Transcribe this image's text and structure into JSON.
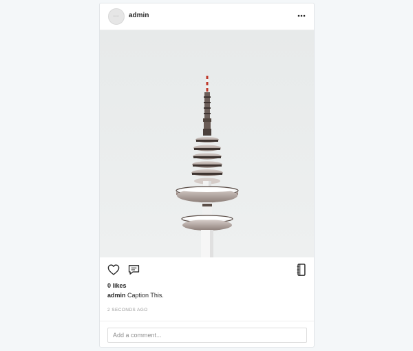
{
  "post": {
    "username": "admin",
    "avatar_icon": "avatar-placeholder-icon",
    "more_icon": "more-options-icon",
    "image_subject": "tower-image",
    "actions": {
      "like_icon": "heart-icon",
      "comment_icon": "comment-icon",
      "bookmark_icon": "bookmark-icon"
    },
    "likes_text": "0 likes",
    "caption": {
      "user": "admin",
      "text": "Caption This."
    },
    "timestamp": "2 seconds ago",
    "comment_placeholder": "Add a comment..."
  },
  "colors": {
    "page_background": "#f4f7f9",
    "card_background": "#ffffff",
    "text_primary": "#262626",
    "text_muted": "#999999",
    "sky": "#e9ebeb",
    "tower_accent_red": "#c0392b"
  }
}
